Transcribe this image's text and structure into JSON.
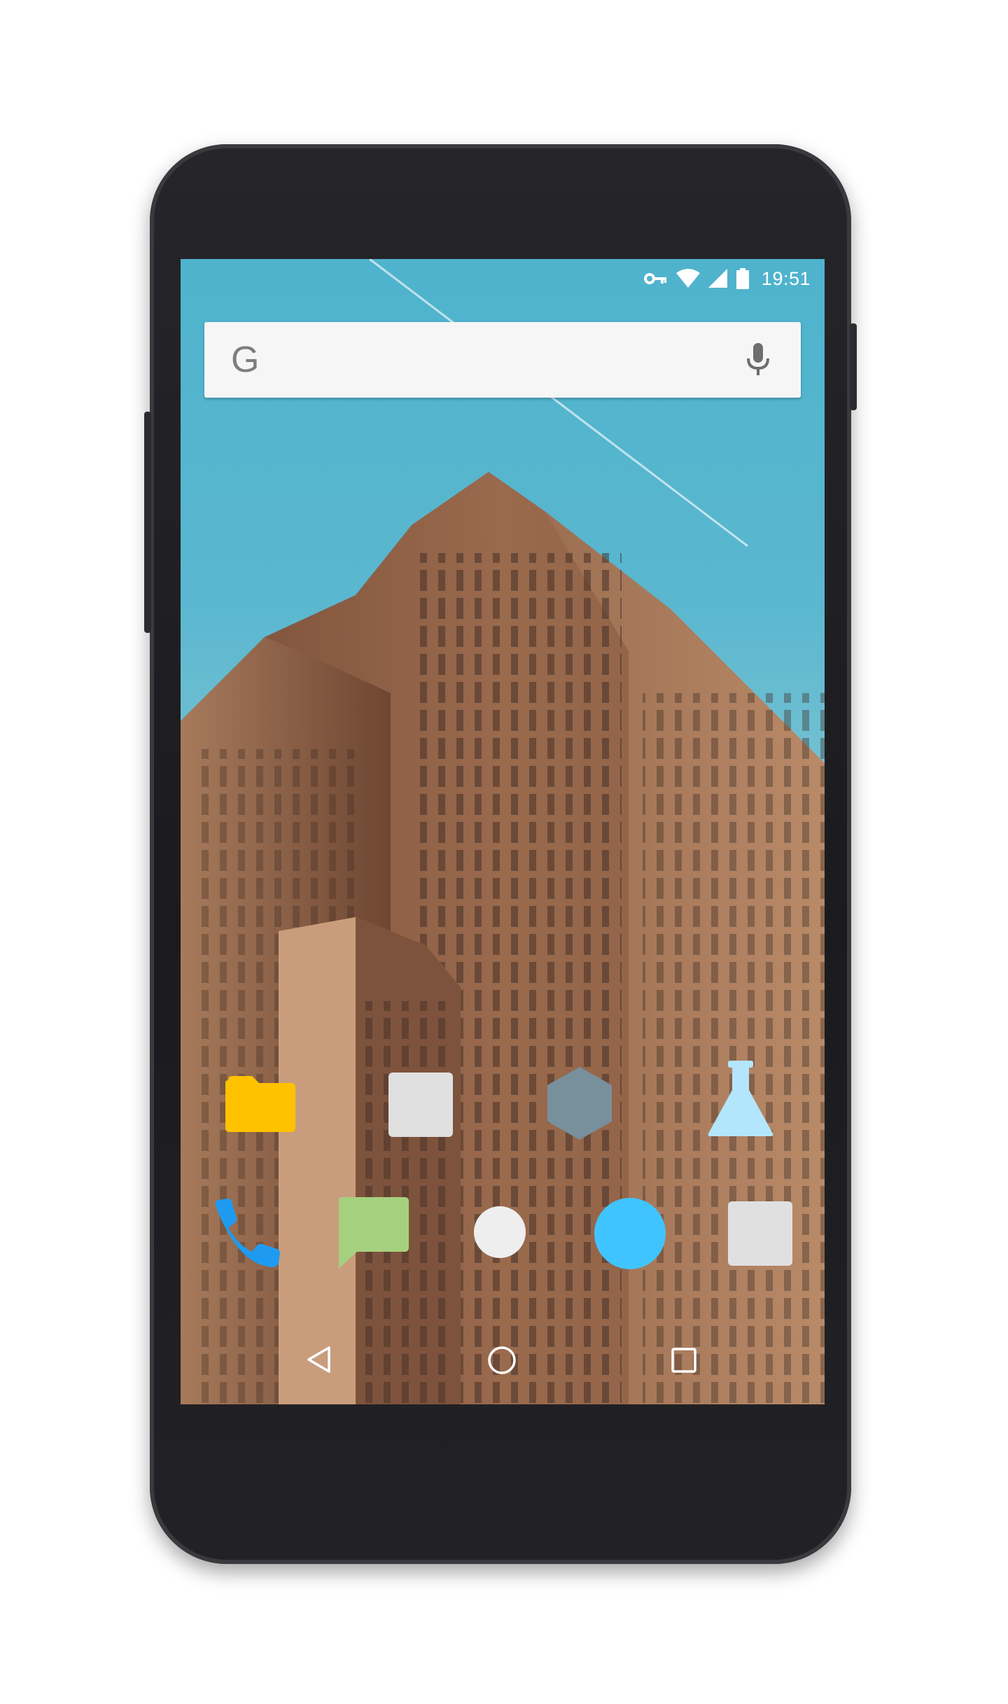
{
  "status_bar": {
    "time": "19:51",
    "icons": [
      "vpn-key-icon",
      "wifi-icon",
      "cell-signal-icon",
      "battery-icon"
    ]
  },
  "search_bar": {
    "logo": "G",
    "icons": [
      "google-logo",
      "mic-icon"
    ]
  },
  "home_row_apps": [
    {
      "icon": "folder-icon",
      "color": "#FFC200"
    },
    {
      "icon": "square-app-icon",
      "color": "#E0E0E0"
    },
    {
      "icon": "hexagon-app-icon",
      "color": "#78909C"
    },
    {
      "icon": "flask-icon",
      "color": "#B3E5FC"
    }
  ],
  "dock_apps": [
    {
      "icon": "phone-icon",
      "color": "#1E9BF0"
    },
    {
      "icon": "message-icon",
      "color": "#A5D17F"
    },
    {
      "icon": "circle-app-icon",
      "color": "#EEEEEE"
    },
    {
      "icon": "circle-app-icon-blue",
      "color": "#40C4FF"
    },
    {
      "icon": "square-app-icon-2",
      "color": "#E0E0E0"
    }
  ],
  "navigation_bar": {
    "buttons": [
      "back-icon",
      "home-icon",
      "recents-icon"
    ]
  },
  "wallpaper": {
    "sky_color": "#53B4CE",
    "building_color": "#8A5E44"
  }
}
